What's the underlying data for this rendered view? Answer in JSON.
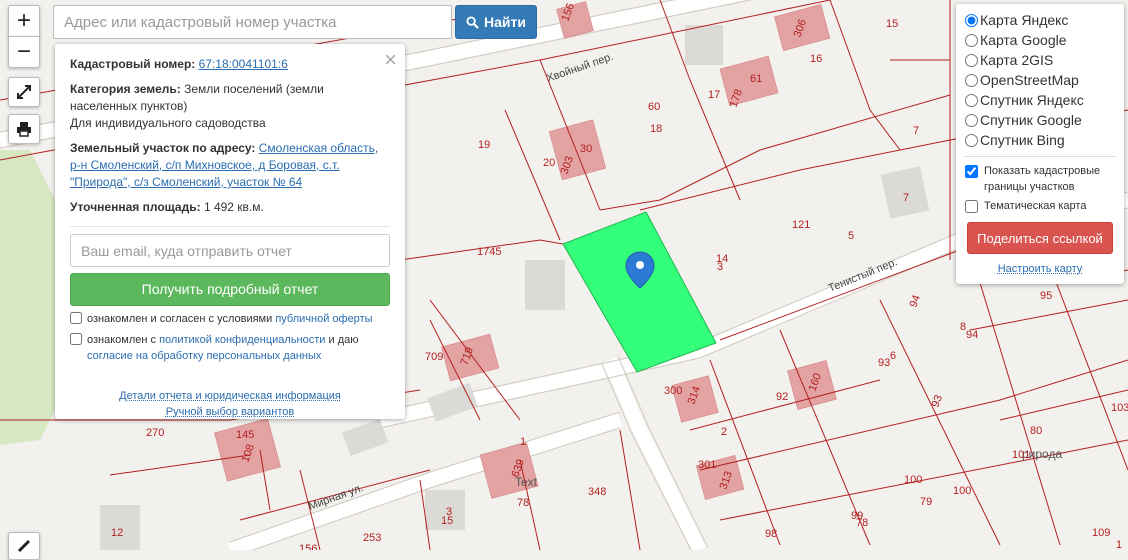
{
  "search": {
    "placeholder": "Адрес или кадастровый номер участка",
    "button_label": "Найти"
  },
  "zoom": {
    "in_label": "+",
    "out_label": "−"
  },
  "popup": {
    "cadastral_label": "Кадастровый номер:",
    "cadastral_value": "67:18:0041101:6",
    "category_label": "Категория земель:",
    "category_value": "Земли поселений (земли населенных пунктов)",
    "usage": "Для индивидуального садоводства",
    "address_label": "Земельный участок по адресу:",
    "address_value": "Смоленская область, р-н Смоленский, с/п Михновское, д Боровая, с.т. \"Природа\", с/з Смоленский, участок № 64",
    "area_label": "Уточненная площадь:",
    "area_value": "1 492 кв.м.",
    "email_placeholder": "Ваш email, куда отправить отчет",
    "report_button": "Получить подробный отчет",
    "offer_text": "ознакомлен и согласен с условиями",
    "offer_link": "публичной оферты",
    "privacy_text_1": "ознакомлен с",
    "privacy_link": "политикой конфиденциальности",
    "privacy_text_2": "и даю",
    "consent_link": "согласие на обработку персональных данных",
    "details_link": "Детали отчета и юридическая информация",
    "manual_link": "Ручной выбор вариантов"
  },
  "layers": {
    "options": [
      "Карта Яндекс",
      "Карта Google",
      "Карта 2GIS",
      "OpenStreetMap",
      "Спутник Яндекс",
      "Спутник Google",
      "Спутник Bing"
    ],
    "selected": "Карта Яндекс",
    "show_borders": "Показать кадастровые границы участков",
    "show_borders_checked": true,
    "thematic": "Тематическая карта",
    "thematic_checked": false,
    "share_button": "Поделиться ссылкой",
    "setup_link": "Настроить карту"
  },
  "map": {
    "streets": {
      "khvoiny": "Хвойный пер.",
      "tenisty": "Тенистый пер.",
      "mirnaya": "Мирная ул.",
      "priroda": "рирода",
      "text": "Text"
    },
    "labels": [
      "156",
      "306",
      "15",
      "61",
      "17",
      "178",
      "60",
      "18",
      "16",
      "7",
      "19",
      "303",
      "20",
      "30",
      "7",
      "121",
      "5",
      "14",
      "3",
      "1745",
      "94",
      "95",
      "8",
      "94",
      "93",
      "6",
      "709",
      "719",
      "300",
      "314",
      "92",
      "160",
      "93",
      "270",
      "145",
      "108",
      "639",
      "1",
      "2",
      "348",
      "80",
      "101",
      "103",
      "301",
      "313",
      "100",
      "100",
      "79",
      "78",
      "12",
      "15",
      "3",
      "253",
      "156",
      "98",
      "99",
      "78",
      "109",
      "1"
    ],
    "colors": {
      "selected_parcel": "#33ff7a",
      "building": "#e3a3a3",
      "parcel_border": "#b32020",
      "marker": "#2b7bd6"
    }
  }
}
